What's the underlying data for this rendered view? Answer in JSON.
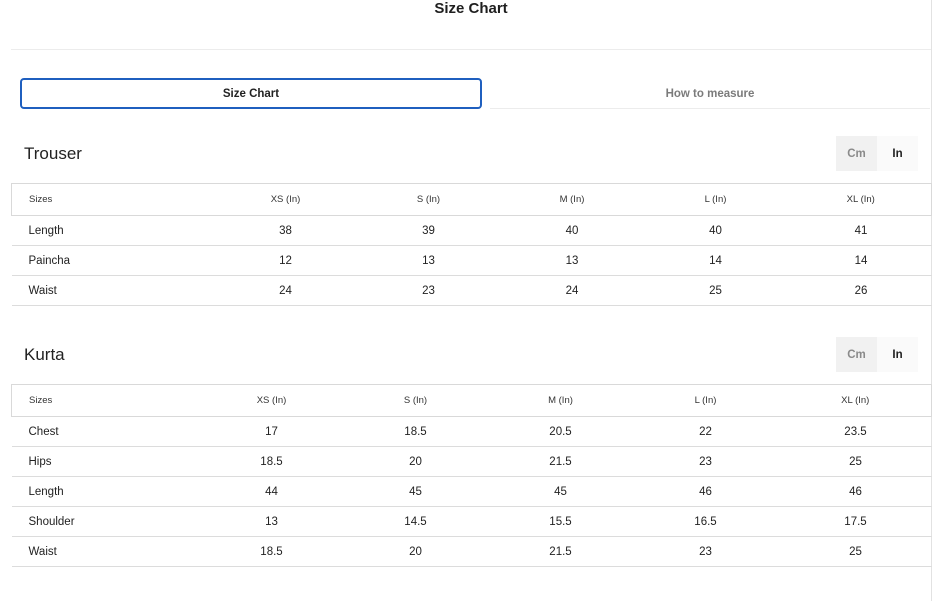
{
  "header": {
    "title": "Size Chart"
  },
  "tabs": [
    {
      "label": "Size Chart",
      "active": true
    },
    {
      "label": "How to measure",
      "active": false
    }
  ],
  "unit_toggle": {
    "cm_label": "Cm",
    "in_label": "In",
    "selected": "In"
  },
  "sections": [
    {
      "title": "Trouser",
      "columns": [
        "Sizes",
        "XS (In)",
        "S (In)",
        "M (In)",
        "L (In)",
        "XL (In)"
      ],
      "rows": [
        [
          "Length",
          "38",
          "39",
          "40",
          "40",
          "41"
        ],
        [
          "Paincha",
          "12",
          "13",
          "13",
          "14",
          "14"
        ],
        [
          "Waist",
          "24",
          "23",
          "24",
          "25",
          "26"
        ]
      ]
    },
    {
      "title": "Kurta",
      "columns": [
        "Sizes",
        "XS (In)",
        "S (In)",
        "M (In)",
        "L (In)",
        "XL (In)"
      ],
      "rows": [
        [
          "Chest",
          "17",
          "18.5",
          "20.5",
          "22",
          "23.5"
        ],
        [
          "Hips",
          "18.5",
          "20",
          "21.5",
          "23",
          "25"
        ],
        [
          "Length",
          "44",
          "45",
          "45",
          "46",
          "46"
        ],
        [
          "Shoulder",
          "13",
          "14.5",
          "15.5",
          "16.5",
          "17.5"
        ],
        [
          "Waist",
          "18.5",
          "20",
          "21.5",
          "23",
          "25"
        ]
      ]
    }
  ]
}
